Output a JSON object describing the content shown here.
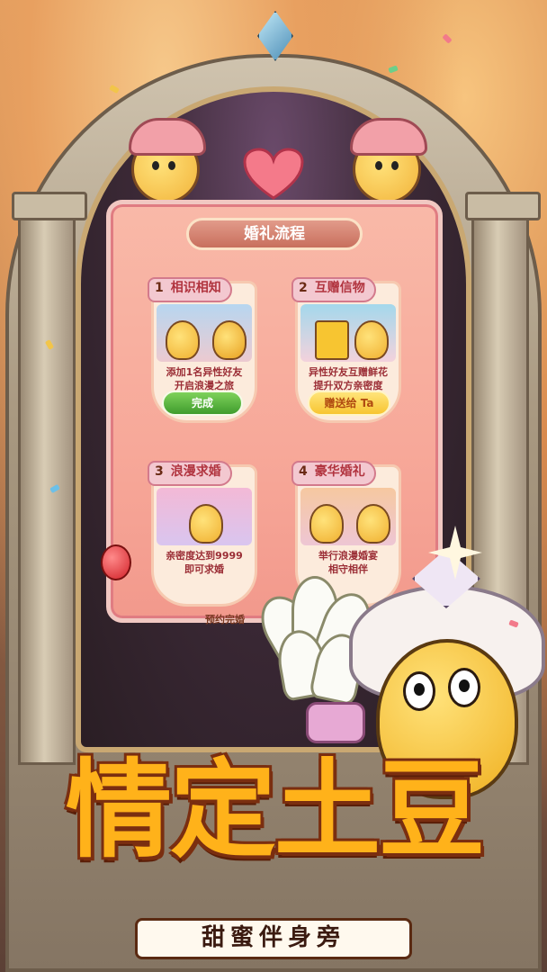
{
  "panel": {
    "header": "婚礼流程",
    "footer_partial": "预约完婚"
  },
  "steps": [
    {
      "num": "1",
      "title": "相识相知",
      "desc": [
        "添加1名异性好友",
        "开启浪漫之旅"
      ],
      "button": "完成",
      "button_style": "green"
    },
    {
      "num": "2",
      "title": "互赠信物",
      "desc": [
        "异性好友互赠鲜花",
        "提升双方亲密度"
      ],
      "button": "赠送给 Ta",
      "button_style": "yellow"
    },
    {
      "num": "3",
      "title": "浪漫求婚",
      "desc": [
        "亲密度达到9999",
        "即可求婚"
      ],
      "button": null
    },
    {
      "num": "4",
      "title": "豪华婚礼",
      "desc": [
        "举行浪漫婚宴",
        "相守相伴"
      ],
      "button": null
    }
  ],
  "banner": {
    "title": "情定土豆",
    "subtitle": "甜蜜伴身旁"
  },
  "colors": {
    "title": "#ffb21a",
    "title_outline": "#7a2e10",
    "panel": "#f7a899",
    "button_green": "#3f9c2d",
    "button_yellow": "#f7c531"
  }
}
